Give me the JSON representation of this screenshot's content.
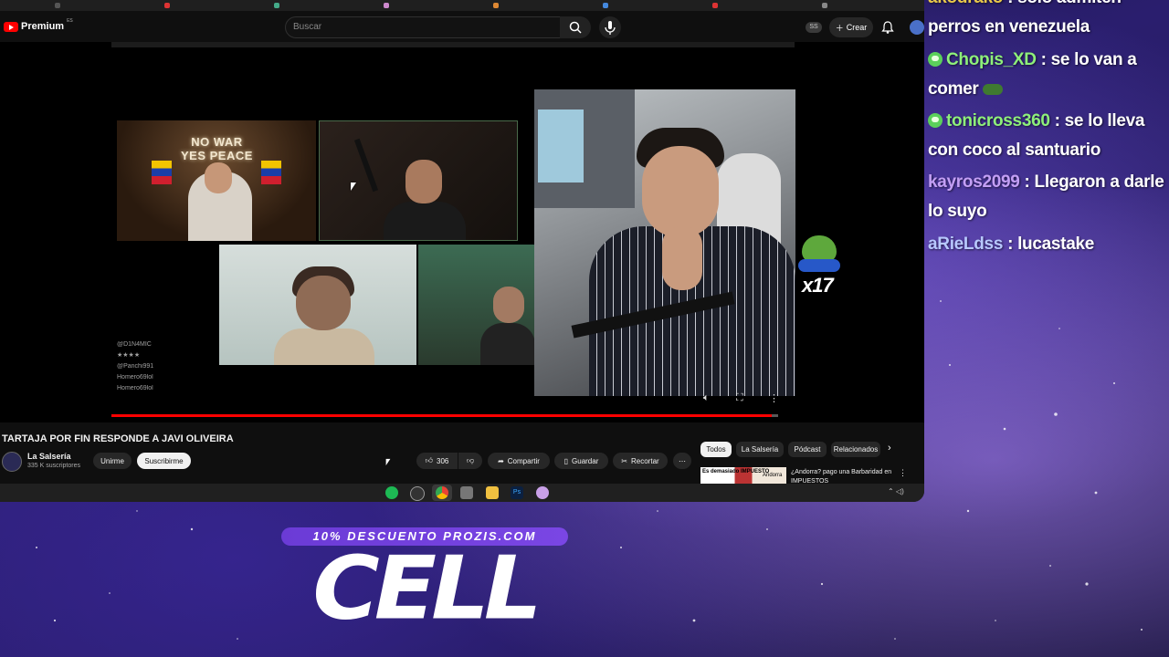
{
  "browser": {
    "logo_text": "Premium",
    "logo_region": "ES",
    "search_placeholder": "Buscar",
    "header_badge": "SS",
    "create_label": "Crear"
  },
  "video": {
    "stream_sign": "NO WAR\nYES PEACE",
    "overlay_chat": [
      "@D1N4MIC",
      "@Panchi991",
      "Homero69lol",
      "Homero69lol"
    ],
    "emote_counter": "x17",
    "progress": 0.99,
    "title": "TARTAJA POR FIN RESPONDE A JAVI OLIVEIRA"
  },
  "channel": {
    "name": "La Salsería",
    "subscribers": "335 K suscriptores",
    "join_label": "Unirme",
    "subscribe_label": "Suscribirme"
  },
  "actions": {
    "likes": "306",
    "share_label": "Compartir",
    "save_label": "Guardar",
    "clip_label": "Recortar"
  },
  "chips": {
    "all": "Todos",
    "channel": "La Salsería",
    "podcast": "Pódcast",
    "related": "Relacionados"
  },
  "recommended": {
    "title": "¿Andorra? pago una Barbaridad en IMPUESTOS",
    "thumb_text_left": "Es demasiado IMPUESTO",
    "thumb_text_right": "Andorra"
  },
  "chat": {
    "messages": [
      {
        "user": "akodrako",
        "text": " : solo admiten perros en venezuela",
        "color": "#e8c84a",
        "badge": false
      },
      {
        "user": "Chopis_XD",
        "text": " : se lo van a comer",
        "color": "#8ef07a",
        "badge": true
      },
      {
        "user": "tonicross360",
        "text": " : se lo lleva con coco al santuario",
        "color": "#8ef07a",
        "badge": true
      },
      {
        "user": "kayros2099",
        "text": " : Llegaron a darle lo suyo",
        "color": "#c39ff5",
        "badge": false
      },
      {
        "user": "aRieLdss",
        "text": " : lucastake",
        "color": "#b8c8ff",
        "badge": false
      }
    ]
  },
  "promo": {
    "banner": "10% DESCUENTO PROZIS.COM",
    "headline": "CELL"
  }
}
